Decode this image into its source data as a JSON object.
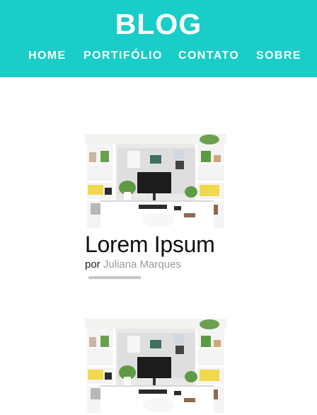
{
  "header": {
    "blog_title": "BLOG",
    "bg_color": "#19cdc8",
    "nav": [
      {
        "label": "HOME"
      },
      {
        "label": "PORTIFÓLIO"
      },
      {
        "label": "CONTATO"
      },
      {
        "label": "SOBRE"
      }
    ]
  },
  "posts": [
    {
      "image": "desk-workspace-photo",
      "title": "Lorem Ipsum",
      "by": "por",
      "author": "Juliana Marques"
    },
    {
      "image": "desk-workspace-photo"
    }
  ]
}
